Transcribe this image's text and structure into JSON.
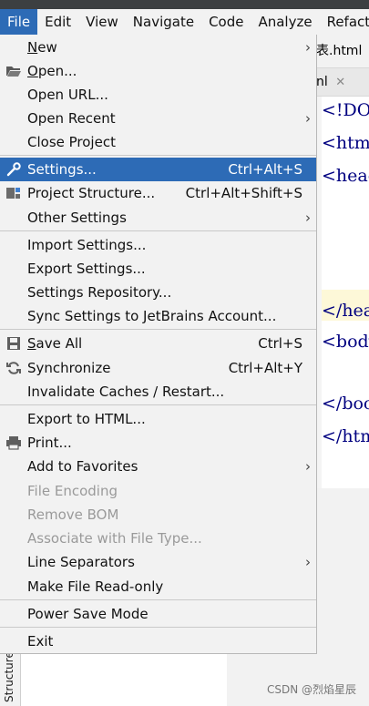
{
  "menubar": {
    "items": [
      "File",
      "Edit",
      "View",
      "Navigate",
      "Code",
      "Analyze",
      "Refactor"
    ]
  },
  "editor": {
    "tab_top": "表.html",
    "tab_second": "nl",
    "code_lines": [
      "<!DOC",
      "<htm",
      "<head",
      "</hea",
      "<body",
      "</boo",
      "</htm"
    ]
  },
  "file_menu": {
    "items": [
      {
        "label": "New",
        "mnemonic": "N",
        "rest": "ew",
        "submenu": true
      },
      {
        "label": "Open...",
        "mnemonic": "O",
        "rest": "pen...",
        "icon": "folder-open-icon"
      },
      {
        "label": "Open URL...",
        "mnemonic": "",
        "rest": "Open URL..."
      },
      {
        "label": "Open Recent",
        "mnemonic": "",
        "rest": "Open Recent",
        "submenu": true
      },
      {
        "label": "Close Project",
        "mnemonic": "",
        "rest": "Close Project"
      },
      {
        "label": "Settings...",
        "mnemonic": "",
        "rest": "Settings...",
        "shortcut": "Ctrl+Alt+S",
        "icon": "wrench-icon",
        "selected": true
      },
      {
        "label": "Project Structure...",
        "mnemonic": "",
        "rest": "Project Structure...",
        "shortcut": "Ctrl+Alt+Shift+S",
        "icon": "project-structure-icon"
      },
      {
        "label": "Other Settings",
        "mnemonic": "",
        "rest": "Other Settings",
        "submenu": true
      },
      {
        "label": "Import Settings...",
        "mnemonic": "",
        "rest": "Import Settings..."
      },
      {
        "label": "Export Settings...",
        "mnemonic": "",
        "rest": "Export Settings..."
      },
      {
        "label": "Settings Repository...",
        "mnemonic": "",
        "rest": "Settings Repository..."
      },
      {
        "label": "Sync Settings to JetBrains Account...",
        "mnemonic": "",
        "rest": "Sync Settings to JetBrains Account..."
      },
      {
        "label": "Save All",
        "mnemonic": "S",
        "rest": "ave All",
        "shortcut": "Ctrl+S",
        "icon": "save-icon"
      },
      {
        "label": "Synchronize",
        "mnemonic": "",
        "rest": "Synchronize",
        "shortcut": "Ctrl+Alt+Y",
        "icon": "synchronize-icon"
      },
      {
        "label": "Invalidate Caches / Restart...",
        "mnemonic": "",
        "rest": "Invalidate Caches / Restart..."
      },
      {
        "label": "Export to HTML...",
        "mnemonic": "",
        "rest": "Export to HTML..."
      },
      {
        "label": "Print...",
        "mnemonic": "",
        "rest": "Print...",
        "icon": "print-icon"
      },
      {
        "label": "Add to Favorites",
        "mnemonic": "",
        "rest": "Add to Favorites",
        "submenu": true
      },
      {
        "label": "File Encoding",
        "mnemonic": "",
        "rest": "File Encoding",
        "disabled": true
      },
      {
        "label": "Remove BOM",
        "mnemonic": "",
        "rest": "Remove BOM",
        "disabled": true
      },
      {
        "label": "Associate with File Type...",
        "mnemonic": "",
        "rest": "Associate with File Type...",
        "disabled": true
      },
      {
        "label": "Line Separators",
        "mnemonic": "",
        "rest": "Line Separators",
        "submenu": true
      },
      {
        "label": "Make File Read-only",
        "mnemonic": "",
        "rest": "Make File Read-only"
      },
      {
        "label": "Power Save Mode",
        "mnemonic": "",
        "rest": "Power Save Mode"
      },
      {
        "label": "Exit",
        "mnemonic": "",
        "rest": "Exit"
      }
    ]
  },
  "bottom": {
    "structure_tab": "Structure",
    "watermark": "CSDN @烈焰星辰"
  },
  "colors": {
    "selection": "#2d6bb6",
    "menu_bg": "#f2f2f2",
    "disabled_text": "#9a9a9a",
    "code_tag": "#000080"
  }
}
